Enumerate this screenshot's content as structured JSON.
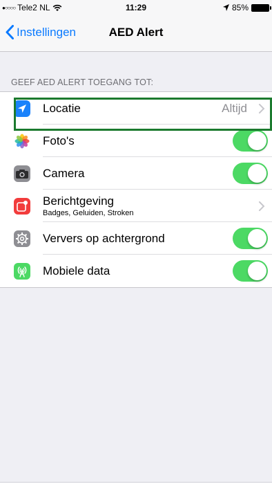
{
  "status_bar": {
    "signal": "●○○○○",
    "carrier": "Tele2 NL",
    "time": "11:29",
    "battery": "85%"
  },
  "nav": {
    "back_label": "Instellingen",
    "title": "AED Alert"
  },
  "section": {
    "header": "GEEF AED ALERT TOEGANG TOT:"
  },
  "rows": [
    {
      "label": "Locatie",
      "value": "Altijd",
      "icon": "location-arrow-icon",
      "icon_color": "#1a82fb"
    },
    {
      "label": "Foto's",
      "toggle": true,
      "icon": "photos-flower-icon"
    },
    {
      "label": "Camera",
      "toggle": true,
      "icon": "camera-icon",
      "icon_color": "#8e8e93"
    },
    {
      "label": "Berichtgeving",
      "subtitle": "Badges, Geluiden, Stroken",
      "icon": "notifications-icon",
      "icon_color": "#f23c3c"
    },
    {
      "label": "Ververs op achtergrond",
      "toggle": true,
      "icon": "gear-icon",
      "icon_color": "#8e8e93"
    },
    {
      "label": "Mobiele data",
      "toggle": true,
      "icon": "cellular-antenna-icon",
      "icon_color": "#4cd964"
    }
  ],
  "colors": {
    "accent": "#0a7aff",
    "toggle_on": "#4cd964",
    "highlight": "#1b7a2e"
  }
}
